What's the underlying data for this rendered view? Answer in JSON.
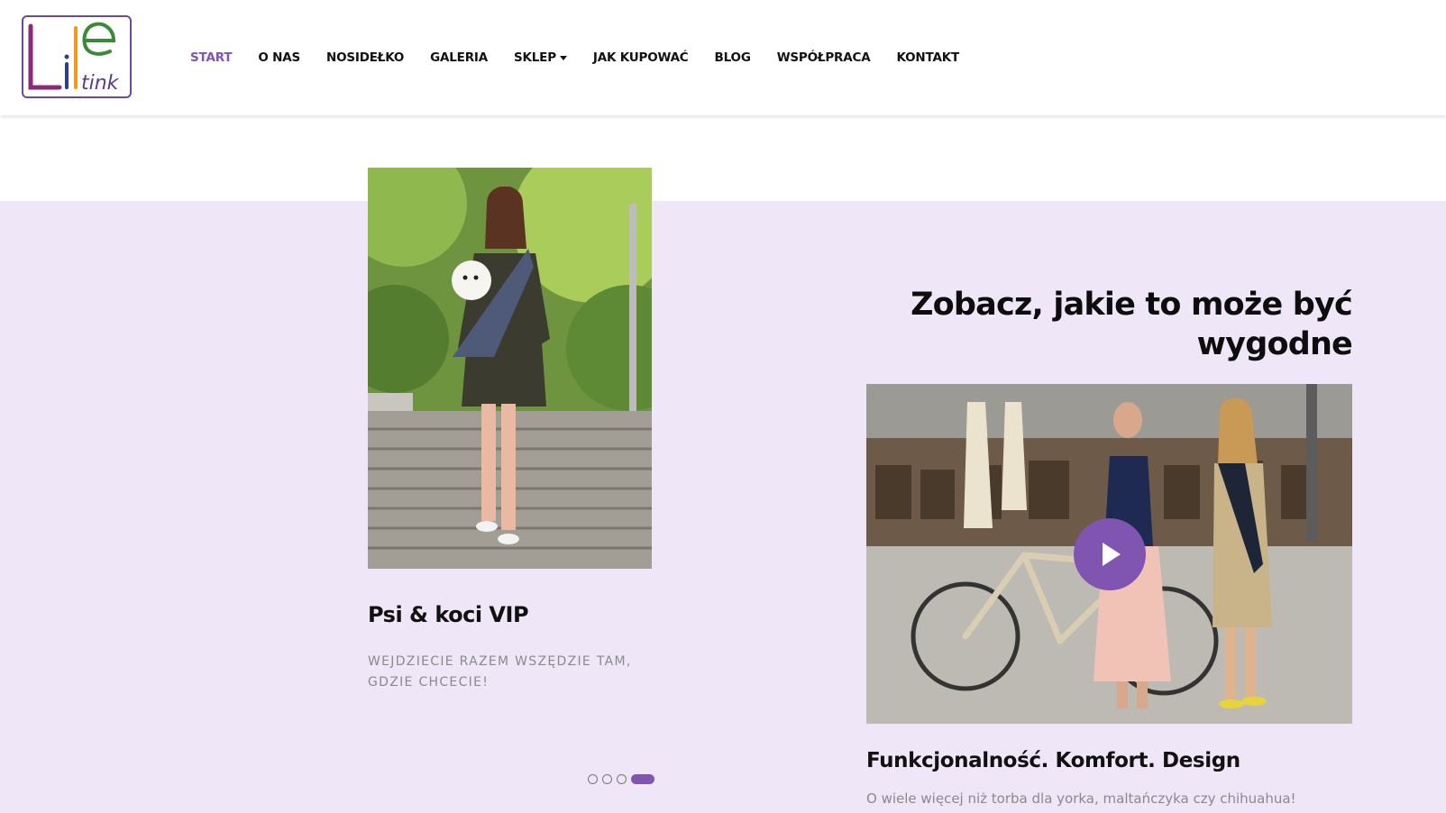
{
  "logo": {
    "alt": "Lile tink"
  },
  "nav": {
    "items": [
      {
        "label": "START"
      },
      {
        "label": "O NAS"
      },
      {
        "label": "NOSIDEŁKO"
      },
      {
        "label": "GALERIA"
      },
      {
        "label": "SKLEP"
      },
      {
        "label": "JAK KUPOWAĆ"
      },
      {
        "label": "BLOG"
      },
      {
        "label": "WSPÓŁPRACA"
      },
      {
        "label": "KONTAKT"
      }
    ]
  },
  "slider": {
    "title": "Psi & koci VIP",
    "subtitle": "WEJDZIECIE RAZEM WSZĘDZIE TAM, GDZIE CHCECIE!",
    "dots_count": 4,
    "active_dot": 4
  },
  "video_section": {
    "heading": "Zobacz, jakie to może być wygodne",
    "feature_title": "Funkcjonalność. Komfort. Design",
    "feature_text": "O wiele więcej niż torba dla yorka, maltańczyka czy chihuahua!"
  },
  "colors": {
    "accent": "#7f55b1",
    "band": "#efe6f8",
    "text": "#111111",
    "muted": "#8a8a8a"
  }
}
